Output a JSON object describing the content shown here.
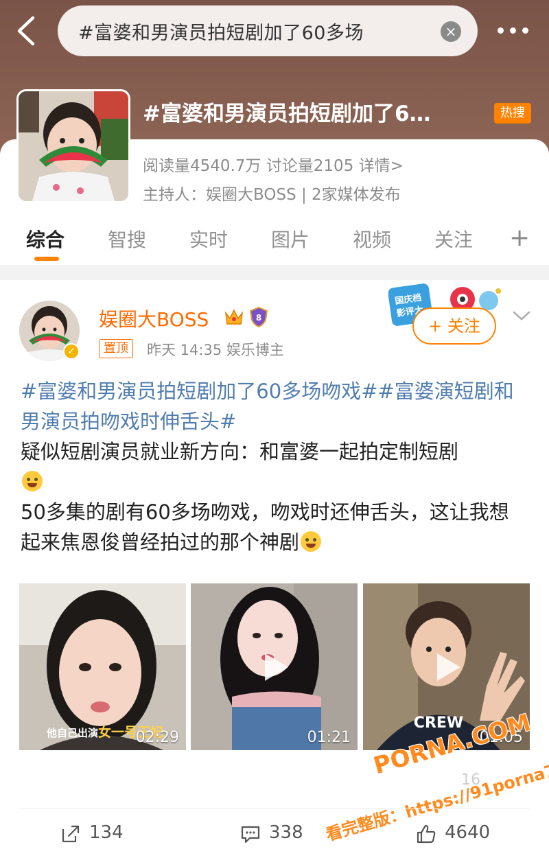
{
  "search": {
    "query": "#富婆和男演员拍短剧加了60多场"
  },
  "topic": {
    "title": "#富婆和男演员拍短剧加了6…",
    "badge": "热搜",
    "stats": "阅读量4540.7万   讨论量2105   详情>",
    "host": "主持人：娱圈大BOSS | 2家媒体发布"
  },
  "tabs": [
    {
      "label": "综合",
      "active": true
    },
    {
      "label": "智搜"
    },
    {
      "label": "实时"
    },
    {
      "label": "图片"
    },
    {
      "label": "视频"
    },
    {
      "label": "关注"
    }
  ],
  "tab_plus": "+",
  "post": {
    "username": "娱圈大BOSS",
    "pin_label": "置顶",
    "meta": "昨天 14:35   娱乐博主",
    "follow_label": "+ 关注",
    "hashtag_text": "#富婆和男演员拍短剧加了60多场吻戏##富婆演短剧和男演员拍吻戏时伸舌头#",
    "line1": "疑似短剧演员就业新方向：和富婆一起拍定制短剧",
    "line2": "50多集的剧有60多场吻戏，吻戏时还伸舌头，这让我想起来焦恩俊曾经拍过的那个神剧",
    "event_banner": "国庆档影评大赛",
    "videos": [
      {
        "duration": "02:29",
        "caption_plain": "他自己出演",
        "caption_highlight": "女一号王妃"
      },
      {
        "duration": "01:21"
      },
      {
        "duration": "01:05",
        "shirt_text": "CREW"
      }
    ],
    "actions": {
      "repost": "134",
      "comment": "338",
      "like": "4640"
    }
  },
  "watermarks": {
    "brand": "PORNA.COM",
    "line": "看完整版：https://91porna73.com",
    "faint": "16"
  },
  "colors": {
    "accent": "#ff8200",
    "username": "#ff6a00",
    "hashtag": "#507daf",
    "header_bg": "#7a5448"
  }
}
